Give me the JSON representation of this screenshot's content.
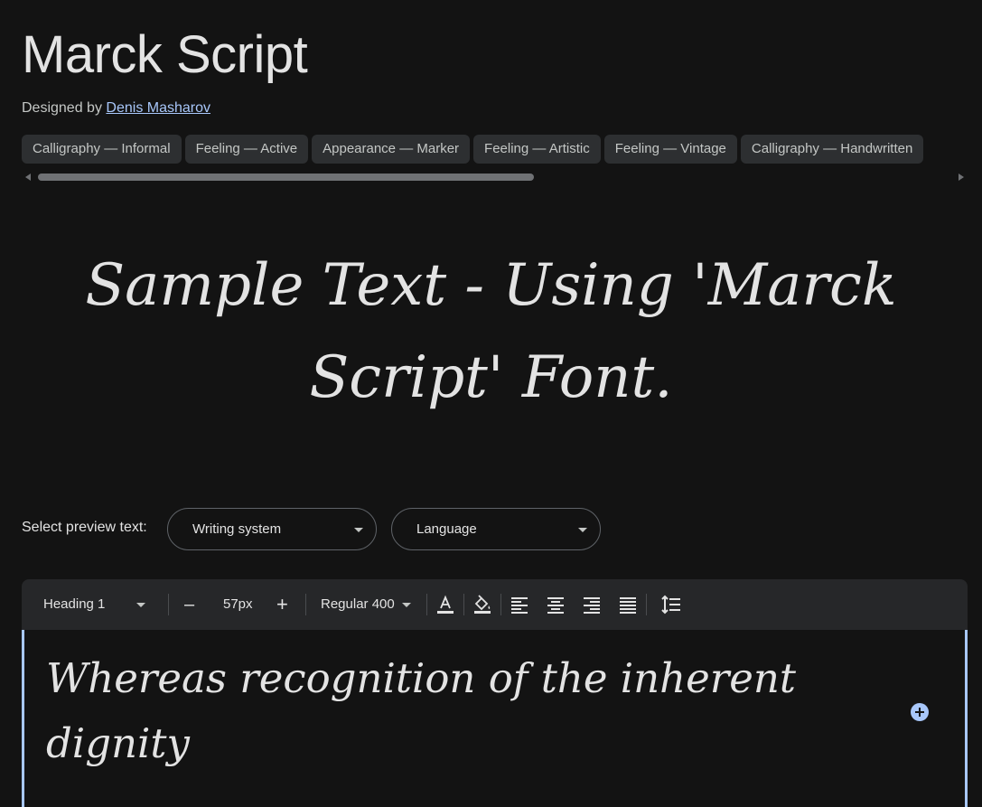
{
  "header": {
    "font_name": "Marck Script",
    "designed_by_prefix": "Designed by",
    "designer_name": "Denis Masharov"
  },
  "tags": [
    "Calligraphy — Informal",
    "Feeling — Active",
    "Appearance — Marker",
    "Feeling — Artistic",
    "Feeling — Vintage",
    "Calligraphy — Handwritten"
  ],
  "sample_text": "Sample Text - Using 'Marck Script' Font.",
  "preview": {
    "label": "Select preview text:",
    "writing_system": "Writing system",
    "language": "Language"
  },
  "toolbar": {
    "style": "Heading 1",
    "decrease": "–",
    "size": "57px",
    "increase": "+",
    "weight": "Regular 400"
  },
  "editor": {
    "text": "Whereas recognition of the inherent dignity"
  },
  "colors": {
    "background": "#131313",
    "accent": "#a8c7fa",
    "chip": "#2d2f31",
    "toolbar": "#262729"
  },
  "icons": [
    "text-color-icon",
    "highlight-color-icon",
    "align-left-icon",
    "align-center-icon",
    "align-right-icon",
    "align-justify-icon",
    "line-height-icon",
    "add-icon"
  ]
}
